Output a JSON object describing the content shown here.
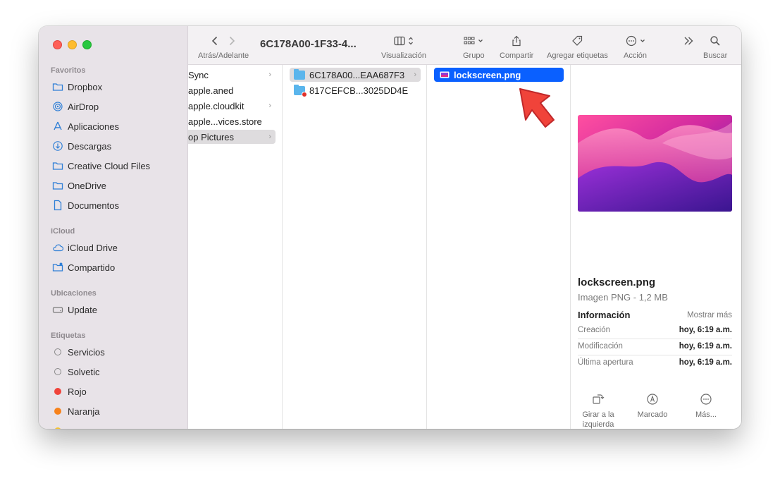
{
  "window": {
    "title": "6C178A00-1F33-4..."
  },
  "sidebar": {
    "sections": [
      {
        "heading": "Favoritos",
        "items": [
          {
            "label": "Dropbox",
            "icon": "folder-icon"
          },
          {
            "label": "AirDrop",
            "icon": "airdrop-icon"
          },
          {
            "label": "Aplicaciones",
            "icon": "applications-icon"
          },
          {
            "label": "Descargas",
            "icon": "download-icon"
          },
          {
            "label": "Creative Cloud Files",
            "icon": "folder-icon"
          },
          {
            "label": "OneDrive",
            "icon": "folder-icon"
          },
          {
            "label": "Documentos",
            "icon": "document-icon"
          }
        ]
      },
      {
        "heading": "iCloud",
        "items": [
          {
            "label": "iCloud Drive",
            "icon": "cloud-icon"
          },
          {
            "label": "Compartido",
            "icon": "shared-folder-icon"
          }
        ]
      },
      {
        "heading": "Ubicaciones",
        "items": [
          {
            "label": "Update",
            "icon": "disk-icon"
          }
        ]
      },
      {
        "heading": "Etiquetas",
        "items": [
          {
            "label": "Servicios",
            "icon": "tag-hollow-icon"
          },
          {
            "label": "Solvetic",
            "icon": "tag-hollow-icon"
          },
          {
            "label": "Rojo",
            "icon": "tag-red-icon",
            "color": "#f0433a"
          },
          {
            "label": "Naranja",
            "icon": "tag-orange-icon",
            "color": "#f7821b"
          }
        ]
      }
    ]
  },
  "toolbar": {
    "back_forward_label": "Atrás/Adelante",
    "view_label": "Visualización",
    "group_label": "Grupo",
    "share_label": "Compartir",
    "tags_label": "Agregar etiquetas",
    "action_label": "Acción",
    "search_label": "Buscar"
  },
  "columns": {
    "col1": [
      "Sync",
      "apple.aned",
      "apple.cloudkit",
      "apple...vices.store",
      "op Pictures"
    ],
    "col2": [
      "6C178A00...EAA687F3",
      "817CEFCB...3025DD4E"
    ],
    "col3": [
      "lockscreen.png"
    ]
  },
  "preview": {
    "file_name": "lockscreen.png",
    "file_type": "Imagen PNG - 1,2 MB",
    "info_heading": "Información",
    "show_more": "Mostrar más",
    "rows": [
      {
        "key": "Creación",
        "value": "hoy, 6:19 a.m."
      },
      {
        "key": "Modificación",
        "value": "hoy, 6:19 a.m."
      },
      {
        "key": "Última apertura",
        "value": "hoy, 6:19 a.m."
      }
    ],
    "actions": [
      {
        "label": "Girar a la izquierda"
      },
      {
        "label": "Marcado"
      },
      {
        "label": "Más..."
      }
    ]
  },
  "colors": {
    "selection_blue": "#0a60ff",
    "annotation_arrow": "#f0433a"
  }
}
